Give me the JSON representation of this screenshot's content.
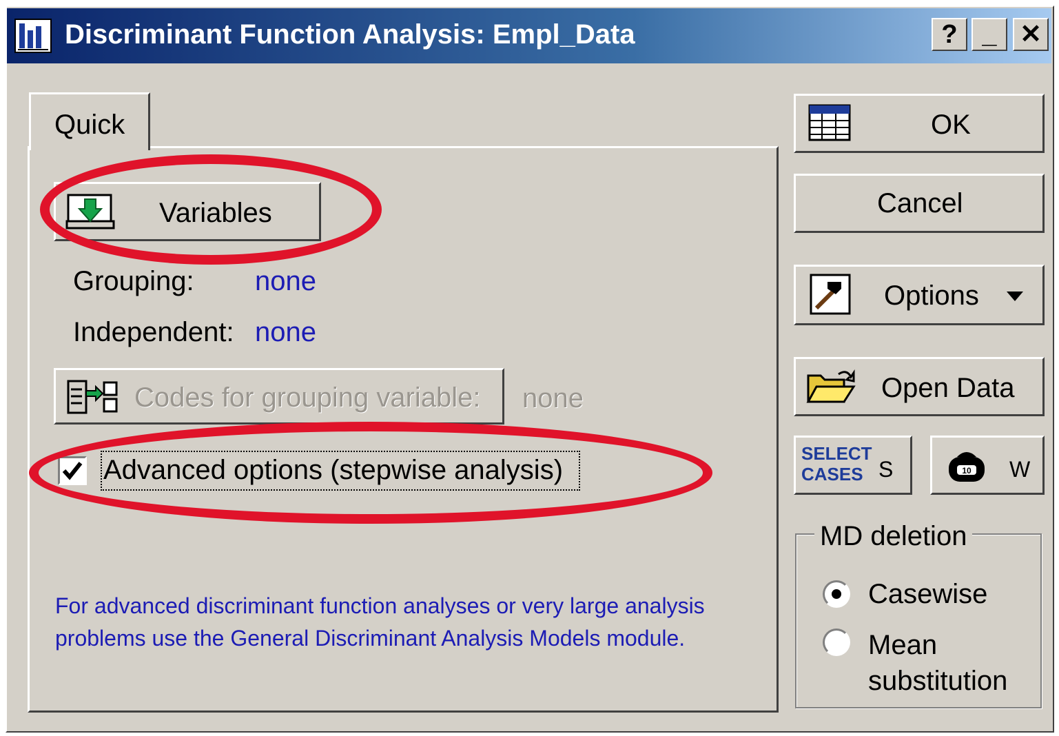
{
  "window": {
    "title": "Discriminant Function Analysis: Empl_Data",
    "help_glyph": "?",
    "minimize_glyph": "_",
    "close_glyph": "✕"
  },
  "tabs": [
    {
      "label": "Quick",
      "selected": true
    }
  ],
  "quick": {
    "variables_button": "Variables",
    "grouping_label": "Grouping:",
    "grouping_value": "none",
    "independent_label": "Independent:",
    "independent_value": "none",
    "codes_button": "Codes for grouping variable:",
    "codes_value": "none",
    "advanced_checkbox_label": "Advanced options (stepwise analysis)",
    "advanced_checked": true,
    "note": "For advanced discriminant function analyses or very large analysis problems use the General Discriminant Analysis Models module."
  },
  "side_buttons": {
    "ok": "OK",
    "cancel": "Cancel",
    "options": "Options",
    "open_data": "Open Data",
    "select_cases_icon_line1": "SELECT",
    "select_cases_icon_line2": "CASES",
    "select_cases_key": "S",
    "weight_key": "W"
  },
  "md_deletion": {
    "legend": "MD deletion",
    "options": [
      {
        "label": "Casewise",
        "selected": true
      },
      {
        "label": "Mean substitution",
        "selected": false
      }
    ]
  },
  "annotation_color": "#e0132a"
}
